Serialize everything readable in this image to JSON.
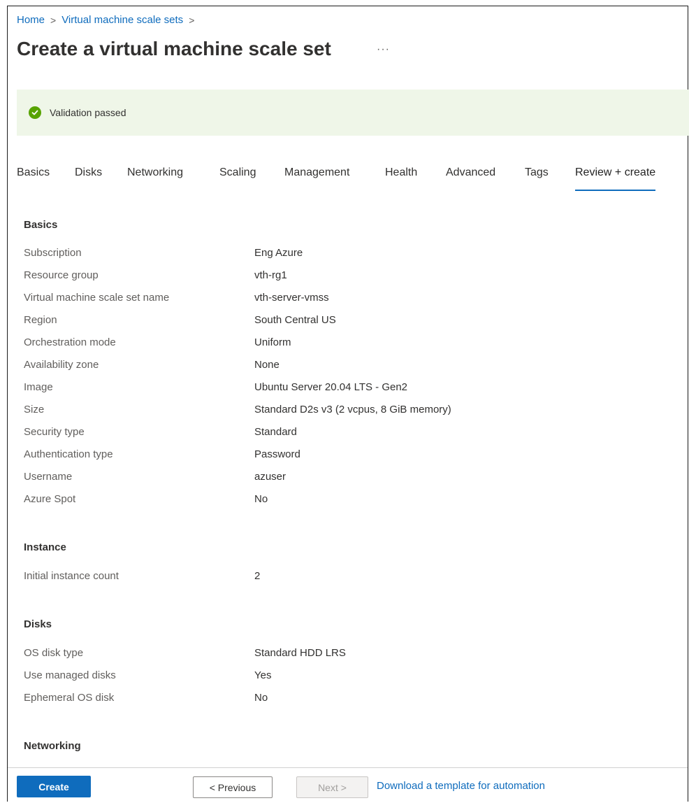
{
  "breadcrumb": {
    "home": "Home",
    "sep": ">",
    "parent": "Virtual machine scale sets"
  },
  "page": {
    "title": "Create a virtual machine scale set",
    "more": "···"
  },
  "banner": {
    "text": "Validation passed"
  },
  "tabs": [
    {
      "label": "Basics"
    },
    {
      "label": "Disks"
    },
    {
      "label": "Networking"
    },
    {
      "label": "Scaling"
    },
    {
      "label": "Management"
    },
    {
      "label": "Health"
    },
    {
      "label": "Advanced"
    },
    {
      "label": "Tags"
    },
    {
      "label": "Review + create"
    }
  ],
  "sections": {
    "basics": {
      "heading": "Basics",
      "rows": [
        {
          "label": "Subscription",
          "value": "Eng Azure"
        },
        {
          "label": "Resource group",
          "value": "vth-rg1"
        },
        {
          "label": "Virtual machine scale set name",
          "value": "vth-server-vmss"
        },
        {
          "label": "Region",
          "value": "South Central US"
        },
        {
          "label": "Orchestration mode",
          "value": "Uniform"
        },
        {
          "label": "Availability zone",
          "value": "None"
        },
        {
          "label": "Image",
          "value": "Ubuntu Server 20.04 LTS - Gen2"
        },
        {
          "label": "Size",
          "value": "Standard D2s v3 (2 vcpus, 8 GiB memory)"
        },
        {
          "label": "Security type",
          "value": "Standard"
        },
        {
          "label": "Authentication type",
          "value": "Password"
        },
        {
          "label": "Username",
          "value": "azuser"
        },
        {
          "label": "Azure Spot",
          "value": "No"
        }
      ]
    },
    "instance": {
      "heading": "Instance",
      "rows": [
        {
          "label": "Initial instance count",
          "value": "2"
        }
      ]
    },
    "disks": {
      "heading": "Disks",
      "rows": [
        {
          "label": "OS disk type",
          "value": "Standard HDD LRS"
        },
        {
          "label": "Use managed disks",
          "value": "Yes"
        },
        {
          "label": "Ephemeral OS disk",
          "value": "No"
        }
      ]
    },
    "networking": {
      "heading": "Networking"
    }
  },
  "footer": {
    "create": "Create",
    "previous": "< Previous",
    "next": "Next >",
    "download": "Download a template for automation"
  },
  "colors": {
    "accent": "#0f6cbd",
    "success": "#57a300",
    "banner_bg": "#eff6e8"
  }
}
